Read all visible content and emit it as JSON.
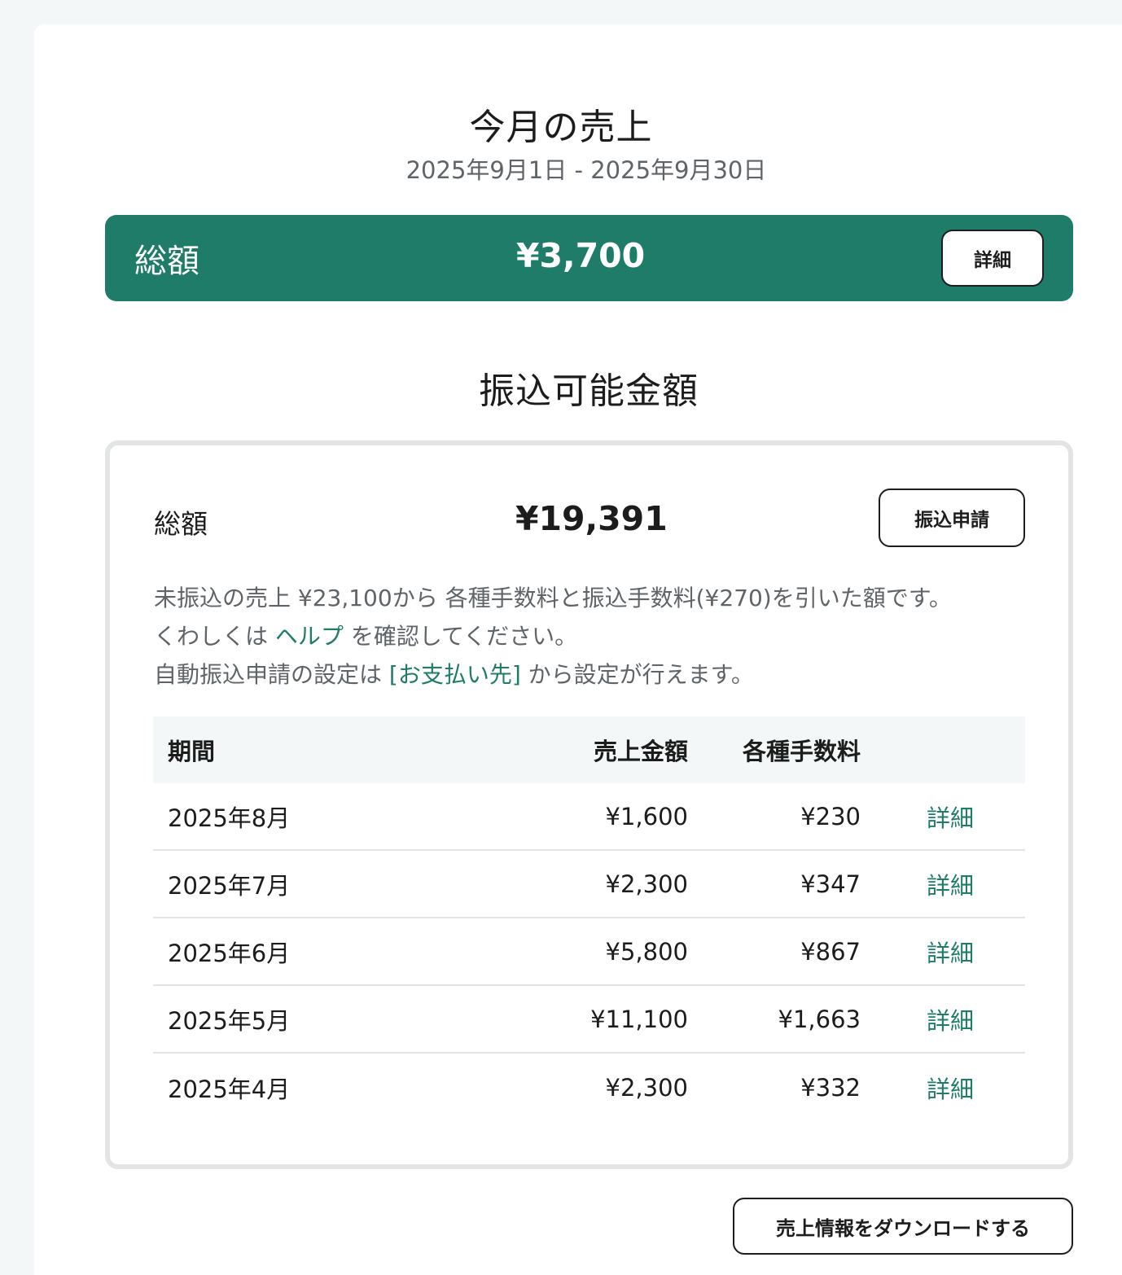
{
  "month_sales": {
    "title": "今月の売上",
    "range": "2025年9月1日 - 2025年9月30日",
    "total_label": "総額",
    "total_amount": "¥3,700",
    "detail_button": "詳細"
  },
  "transferable": {
    "title": "振込可能金額",
    "total_label": "総額",
    "total_amount": "¥19,391",
    "apply_button": "振込申請",
    "desc": {
      "line1": "未振込の売上 ¥23,100から 各種手数料と振込手数料(¥270)を引いた額です。",
      "line2_pre": "くわしくは ",
      "line2_link": "ヘルプ",
      "line2_post": " を確認してください。",
      "line3_pre": "自動振込申請の設定は ",
      "line3_link": "[お支払い先]",
      "line3_post": " から設定が行えます。"
    },
    "table": {
      "headers": {
        "period": "期間",
        "sales": "売上金額",
        "fee": "各種手数料"
      },
      "rows": [
        {
          "period": "2025年8月",
          "sales": "¥1,600",
          "fee": "¥230",
          "detail": "詳細"
        },
        {
          "period": "2025年7月",
          "sales": "¥2,300",
          "fee": "¥347",
          "detail": "詳細"
        },
        {
          "period": "2025年6月",
          "sales": "¥5,800",
          "fee": "¥867",
          "detail": "詳細"
        },
        {
          "period": "2025年5月",
          "sales": "¥11,100",
          "fee": "¥1,663",
          "detail": "詳細"
        },
        {
          "period": "2025年4月",
          "sales": "¥2,300",
          "fee": "¥332",
          "detail": "詳細"
        }
      ]
    }
  },
  "download_button": "売上情報をダウンロードする",
  "colors": {
    "brand_green": "#1f7c69",
    "page_background": "#f4f7f7",
    "muted_text": "#5f6468"
  }
}
